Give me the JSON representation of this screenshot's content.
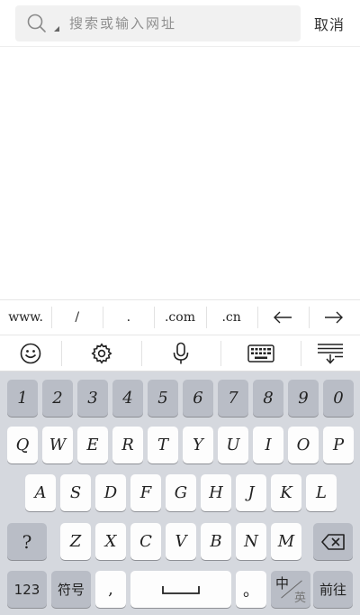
{
  "search": {
    "placeholder": "搜索或输入网址",
    "cancel_label": "取消"
  },
  "url_shortcuts": [
    "www.",
    "/",
    ".",
    ".com",
    ".cn"
  ],
  "toolbar": {
    "items": [
      "emoji-icon",
      "settings-icon",
      "microphone-icon",
      "keyboard-icon",
      "keyboard-hide-icon"
    ]
  },
  "keyboard": {
    "number_row": [
      "1",
      "2",
      "3",
      "4",
      "5",
      "6",
      "7",
      "8",
      "9",
      "0"
    ],
    "row1": [
      "Q",
      "W",
      "E",
      "R",
      "T",
      "Y",
      "U",
      "I",
      "O",
      "P"
    ],
    "row2": [
      "A",
      "S",
      "D",
      "F",
      "G",
      "H",
      "J",
      "K",
      "L"
    ],
    "row3": [
      "Z",
      "X",
      "C",
      "V",
      "B",
      "N",
      "M"
    ],
    "shift_label": "?",
    "numbers_label": "123",
    "symbols_label": "符号",
    "comma_label": ",",
    "period_label": "。",
    "lang_zh": "中",
    "lang_en": "英",
    "go_label": "前往"
  }
}
